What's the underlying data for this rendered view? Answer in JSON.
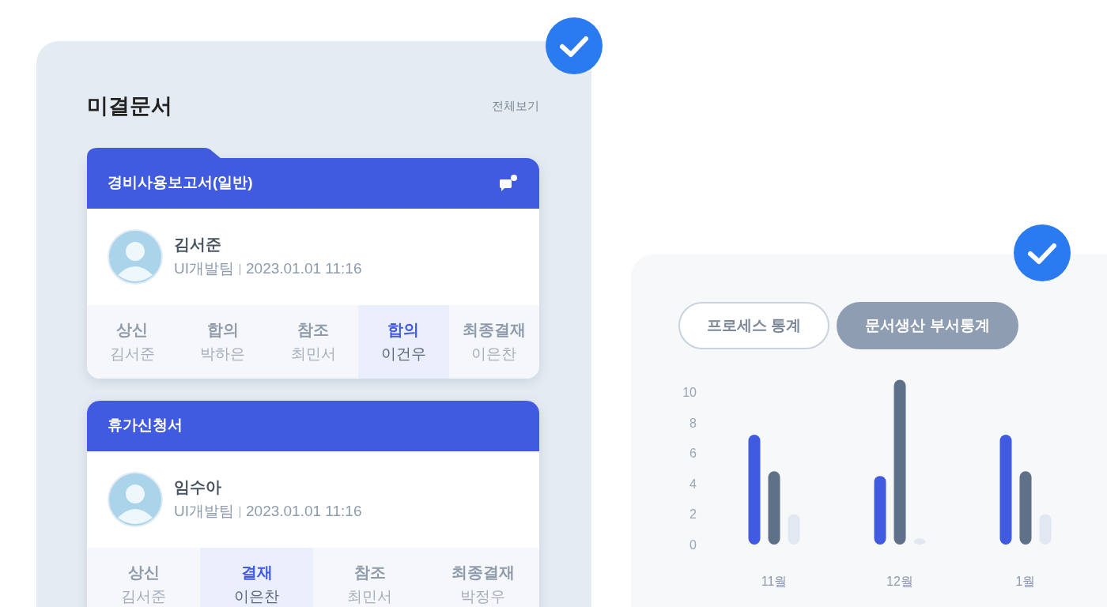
{
  "pending_documents": {
    "title": "미결문서",
    "view_all": "전체보기",
    "checked": true,
    "cards": [
      {
        "title": "경비사용보고서(일반)",
        "folder_tab": true,
        "message_icon": true,
        "author": "김서준",
        "team": "UI개발팀",
        "datetime": "2023.01.01 11:16",
        "steps": [
          {
            "label": "상신",
            "name": "김서준",
            "selected": false
          },
          {
            "label": "합의",
            "name": "박하은",
            "selected": false
          },
          {
            "label": "참조",
            "name": "최민서",
            "selected": false
          },
          {
            "label": "합의",
            "name": "이건우",
            "selected": true
          },
          {
            "label": "최종결재",
            "name": "이은찬",
            "selected": false
          }
        ]
      },
      {
        "title": "휴가신청서",
        "folder_tab": false,
        "message_icon": false,
        "author": "임수아",
        "team": "UI개발팀",
        "datetime": "2023.01.01 11:16",
        "steps": [
          {
            "label": "상신",
            "name": "김서준",
            "selected": false
          },
          {
            "label": "결재",
            "name": "이은찬",
            "selected": true
          },
          {
            "label": "참조",
            "name": "최민서",
            "selected": false
          },
          {
            "label": "최종결재",
            "name": "박정우",
            "selected": false
          }
        ]
      }
    ]
  },
  "statistics": {
    "checked": true,
    "tabs": [
      {
        "label": "프로세스 통계",
        "selected": false
      },
      {
        "label": "문서생산 부서통계",
        "selected": true
      }
    ],
    "chart_data": {
      "type": "bar",
      "categories": [
        "11월",
        "12월",
        "1월"
      ],
      "series": [
        {
          "color": "#405ae0",
          "values": [
            7.2,
            4.5,
            7.2
          ]
        },
        {
          "color": "#5f7188",
          "values": [
            4.8,
            10.8,
            4.8
          ]
        },
        {
          "color": "#e1e8f2",
          "values": [
            2,
            0.4,
            2
          ]
        }
      ],
      "ylim": [
        0,
        11
      ],
      "yticks": [
        0,
        2,
        4,
        6,
        8,
        10
      ]
    }
  }
}
